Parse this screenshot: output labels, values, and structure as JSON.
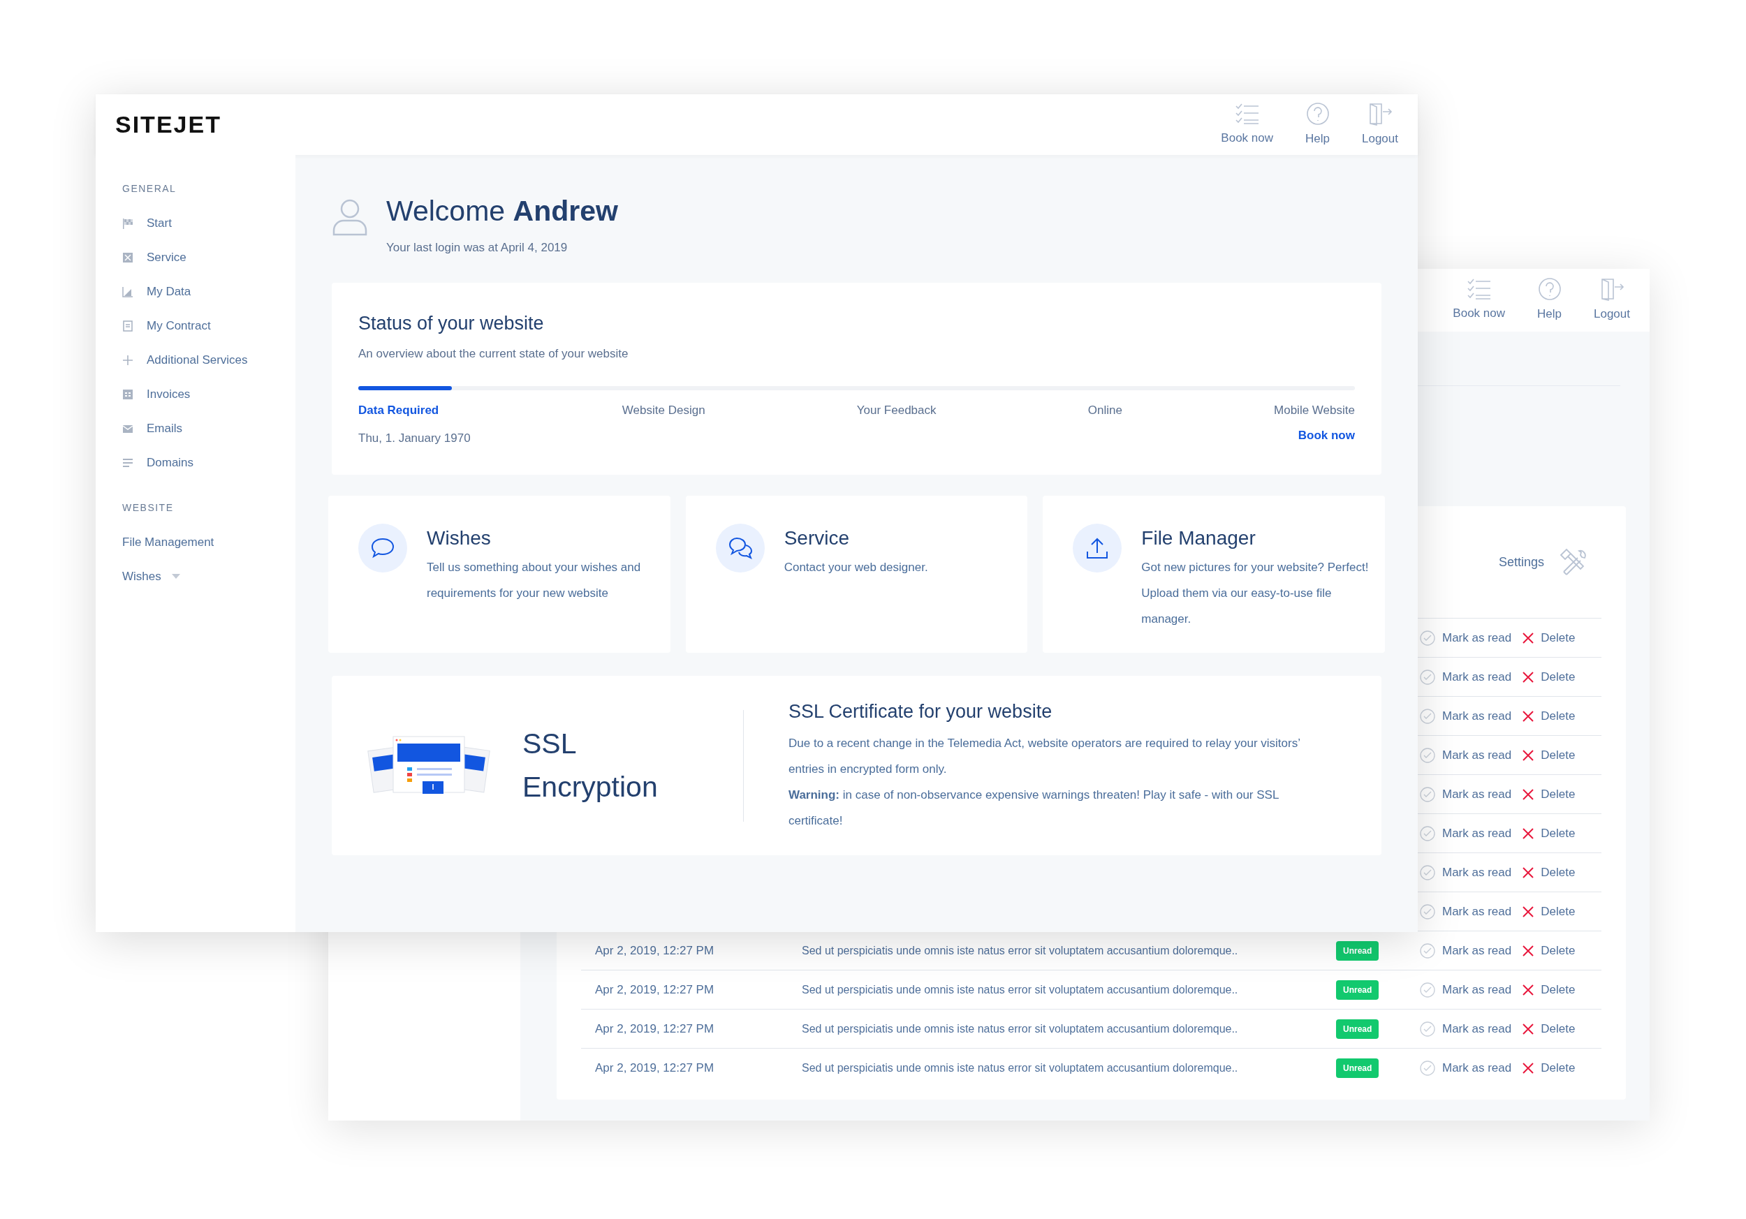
{
  "back_window": {
    "header": {
      "actions": [
        {
          "label": "Book now"
        },
        {
          "label": "Help"
        },
        {
          "label": "Logout"
        }
      ]
    },
    "settings": "Settings",
    "rows": [
      {
        "mark": "Mark as read",
        "delete": "Delete"
      },
      {
        "mark": "Mark as read",
        "delete": "Delete"
      },
      {
        "mark": "Mark as read",
        "delete": "Delete"
      },
      {
        "mark": "Mark as read",
        "delete": "Delete"
      },
      {
        "mark": "Mark as read",
        "delete": "Delete"
      },
      {
        "mark": "Mark as read",
        "delete": "Delete"
      },
      {
        "mark": "Mark as read",
        "delete": "Delete"
      },
      {
        "mark": "Mark as read",
        "delete": "Delete"
      },
      {
        "date": "Apr 2, 2019, 12:27 PM",
        "message": "Sed ut perspiciatis unde omnis iste natus error sit voluptatem accusantium doloremque..",
        "status": "Unread",
        "mark": "Mark as read",
        "delete": "Delete"
      },
      {
        "date": "Apr 2, 2019, 12:27 PM",
        "message": "Sed ut perspiciatis unde omnis iste natus error sit voluptatem accusantium doloremque..",
        "status": "Unread",
        "mark": "Mark as read",
        "delete": "Delete"
      },
      {
        "date": "Apr 2, 2019, 12:27 PM",
        "message": "Sed ut perspiciatis unde omnis iste natus error sit voluptatem accusantium doloremque..",
        "status": "Unread",
        "mark": "Mark as read",
        "delete": "Delete"
      },
      {
        "date": "Apr 2, 2019, 12:27 PM",
        "message": "Sed ut perspiciatis unde omnis iste natus error sit voluptatem accusantium doloremque..",
        "status": "Unread",
        "mark": "Mark as read",
        "delete": "Delete"
      }
    ]
  },
  "front_window": {
    "header": {
      "logo": "SITEJET",
      "actions": [
        {
          "label": "Book now"
        },
        {
          "label": "Help"
        },
        {
          "label": "Logout"
        }
      ]
    },
    "sidebar": {
      "sections": [
        {
          "heading": "GENERAL",
          "items": [
            {
              "label": "Start",
              "kind": "icon"
            },
            {
              "label": "Service",
              "kind": "icon"
            },
            {
              "label": "My Data",
              "kind": "icon"
            },
            {
              "label": "My Contract",
              "kind": "icon"
            },
            {
              "label": "Additional Services",
              "kind": "icon"
            },
            {
              "label": "Invoices",
              "kind": "icon"
            },
            {
              "label": "Emails",
              "kind": "icon"
            },
            {
              "label": "Domains",
              "kind": "icon"
            }
          ]
        },
        {
          "heading": "WEBSITE",
          "items": [
            {
              "label": "File Management",
              "kind": "link"
            },
            {
              "label": "Wishes",
              "kind": "dropdown"
            }
          ]
        }
      ]
    },
    "welcome": {
      "greeting": "Welcome",
      "name": "Andrew",
      "last_login": "Your last login was at April 4, 2019"
    },
    "status": {
      "title": "Status of your website",
      "subtitle": "An overview about the current state of your website",
      "level": 0.094,
      "steps": [
        {
          "label": "Data Required",
          "selected": true
        },
        {
          "label": "Website Design",
          "selected": false
        },
        {
          "label": "Your Feedback",
          "selected": false
        },
        {
          "label": "Online",
          "selected": false
        },
        {
          "label": "Mobile Website",
          "selected": false
        }
      ],
      "date": "Thu, 1. January 1970",
      "link": "Book now"
    },
    "cards": [
      {
        "title": "Wishes",
        "description": "Tell us something about your wishes and requirements for your new website"
      },
      {
        "title": "Service",
        "description": "Contact your web designer."
      },
      {
        "title": "File Manager",
        "description": "Got new pictures for your website? Perfect! Upload them via our easy-to-use file manager."
      }
    ],
    "ssl": {
      "heading": "SSL Encryption",
      "title": "SSL Certificate for your website",
      "text": "Due to a recent change in the Telemedia Act, website operators are required to relay your visitors’ entries in encrypted form only.",
      "warning": "**Warning:** in case of non-observance expensive warnings threaten! Play it safe - with our SSL certificate!"
    }
  }
}
